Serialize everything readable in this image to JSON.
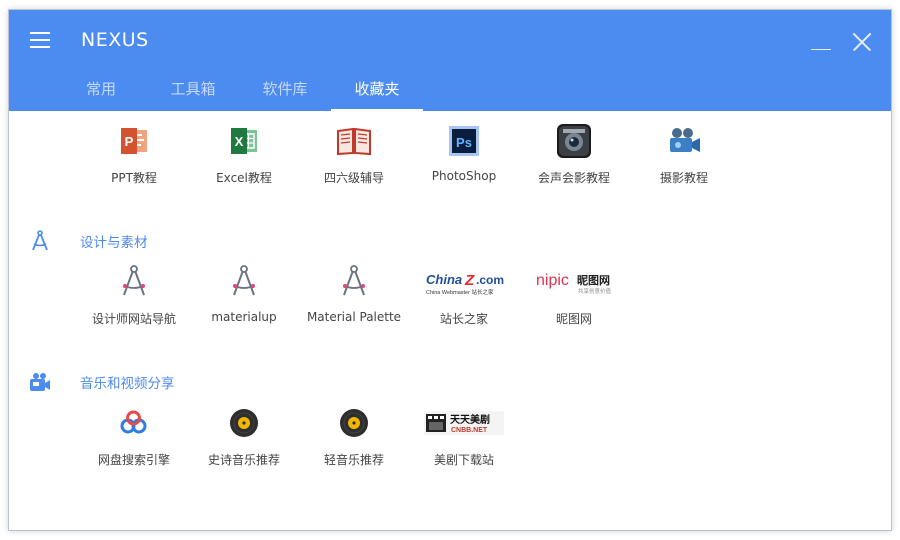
{
  "app": {
    "title": "NEXUS"
  },
  "tabs": [
    {
      "label": "常用",
      "active": false
    },
    {
      "label": "工具箱",
      "active": false
    },
    {
      "label": "软件库",
      "active": false
    },
    {
      "label": "收藏夹",
      "active": true
    }
  ],
  "top_row": [
    {
      "label": "PPT教程",
      "icon": "powerpoint-icon"
    },
    {
      "label": "Excel教程",
      "icon": "excel-icon"
    },
    {
      "label": "四六级辅导",
      "icon": "open-book-icon"
    },
    {
      "label": "PhotoShop",
      "icon": "photoshop-icon"
    },
    {
      "label": "会声会影教程",
      "icon": "video-editor-icon"
    },
    {
      "label": "摄影教程",
      "icon": "video-camera-icon"
    }
  ],
  "sections": [
    {
      "title": "设计与素材",
      "icon": "compass-icon",
      "items": [
        {
          "label": "设计师网站导航",
          "icon": "compass-icon"
        },
        {
          "label": "materialup",
          "icon": "compass-icon"
        },
        {
          "label": "Material Palette",
          "icon": "compass-icon"
        },
        {
          "label": "站长之家",
          "icon": "chinaz-logo-icon",
          "logo_main": "China",
          "logo_mid": "Z",
          "logo_dot": ".com",
          "logo_sub": "China Webmaster 站长之家"
        },
        {
          "label": "昵图网",
          "icon": "nipic-logo-icon",
          "logo_main": "nipic",
          "logo_cn": "昵图网",
          "logo_sub": "共享创意价值"
        }
      ]
    },
    {
      "title": "音乐和视频分享",
      "icon": "video-share-icon",
      "items": [
        {
          "label": "网盘搜索引擎",
          "icon": "cloud-search-icon"
        },
        {
          "label": "史诗音乐推荐",
          "icon": "vinyl-record-icon"
        },
        {
          "label": "轻音乐推荐",
          "icon": "vinyl-record-icon"
        },
        {
          "label": "美剧下载站",
          "icon": "ttmj-logo-icon",
          "logo_main": "天天美剧",
          "logo_sub": "CNBB.NET"
        }
      ]
    }
  ],
  "colors": {
    "accent": "#4c8bf0",
    "header": "#4c8bf0",
    "tab_inactive": "#c6dafc"
  }
}
